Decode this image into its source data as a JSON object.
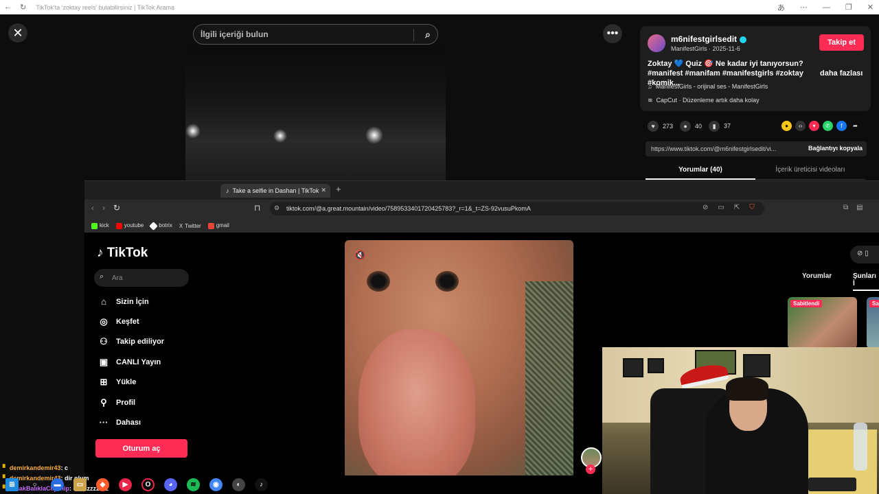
{
  "outer_window": {
    "title": "TikTok'ta 'zoktay reels' bulabilirsiniz | TikTok Arama"
  },
  "overlay": {
    "search_placeholder": "İlgili içeriği bulun",
    "close_label": "✕",
    "more_label": "•••"
  },
  "post": {
    "author": "m6nifestgirlsedit",
    "author_meta": "ManifestGirls · 2025-11-6",
    "follow_label": "Takip et",
    "description": "Zoktay 💙 Quiz 🎯 Ne kadar iyi tanıyorsun? #manifest #manifam #manifestgirls #zoktay #komik...",
    "more_label": "daha fazlası",
    "music": "ManifestGirls - orijinal ses - ManifestGirls",
    "capcut": "CapCut · Düzenleme artık daha kolay",
    "likes": "273",
    "comments": "40",
    "saves": "37",
    "link": "https://www.tiktok.com/@m6nifestgirlsedit/vi...",
    "copy_label": "Bağlantıyı kopyala",
    "tab_comments": "Yorumlar (40)",
    "tab_creator": "İçerik üreticisi videoları"
  },
  "inner_browser": {
    "tab_title": "Take a selfie in Dashan | TikTok",
    "url": "tiktok.com/@a.great.mountain/video/7589533401720425783?_r=1&_t=ZS-92vusuPkomA",
    "bookmarks": [
      {
        "label": "kick",
        "color": "#53fc18"
      },
      {
        "label": "youtube",
        "color": "#ff0000"
      },
      {
        "label": "botrix",
        "color": "#ffffff"
      },
      {
        "label": "Twitter",
        "color": "#dddddd"
      },
      {
        "label": "gmail",
        "color": "#ea4335"
      }
    ]
  },
  "tiktok": {
    "logo": "TikTok",
    "search_placeholder": "Ara",
    "nav": [
      {
        "label": "Sizin İçin",
        "icon": "home-icon"
      },
      {
        "label": "Keşfet",
        "icon": "compass-icon"
      },
      {
        "label": "Takip ediliyor",
        "icon": "following-icon"
      },
      {
        "label": "CANLI Yayın",
        "icon": "live-icon"
      },
      {
        "label": "Yükle",
        "icon": "upload-icon"
      },
      {
        "label": "Profil",
        "icon": "profile-icon"
      },
      {
        "label": "Dahası",
        "icon": "more-icon"
      }
    ],
    "login_label": "Oturum aç",
    "right_tabs": {
      "comments": "Yorumlar",
      "sunlar": "Şunları İ"
    },
    "pinned_label": "Sabitlendi",
    "pinned_label_2": "Sa"
  },
  "chat": [
    {
      "user": "demirkandemir43",
      "msg": ": c"
    },
    {
      "user": "demirkandemir43",
      "msg": ": dir olum"
    },
    {
      "user": "IrmakBalıklaClipClip",
      "msg": ": edilzzzzzzzz"
    }
  ],
  "colors": {
    "accent": "#fe2c55",
    "verified": "#20d5ec"
  }
}
